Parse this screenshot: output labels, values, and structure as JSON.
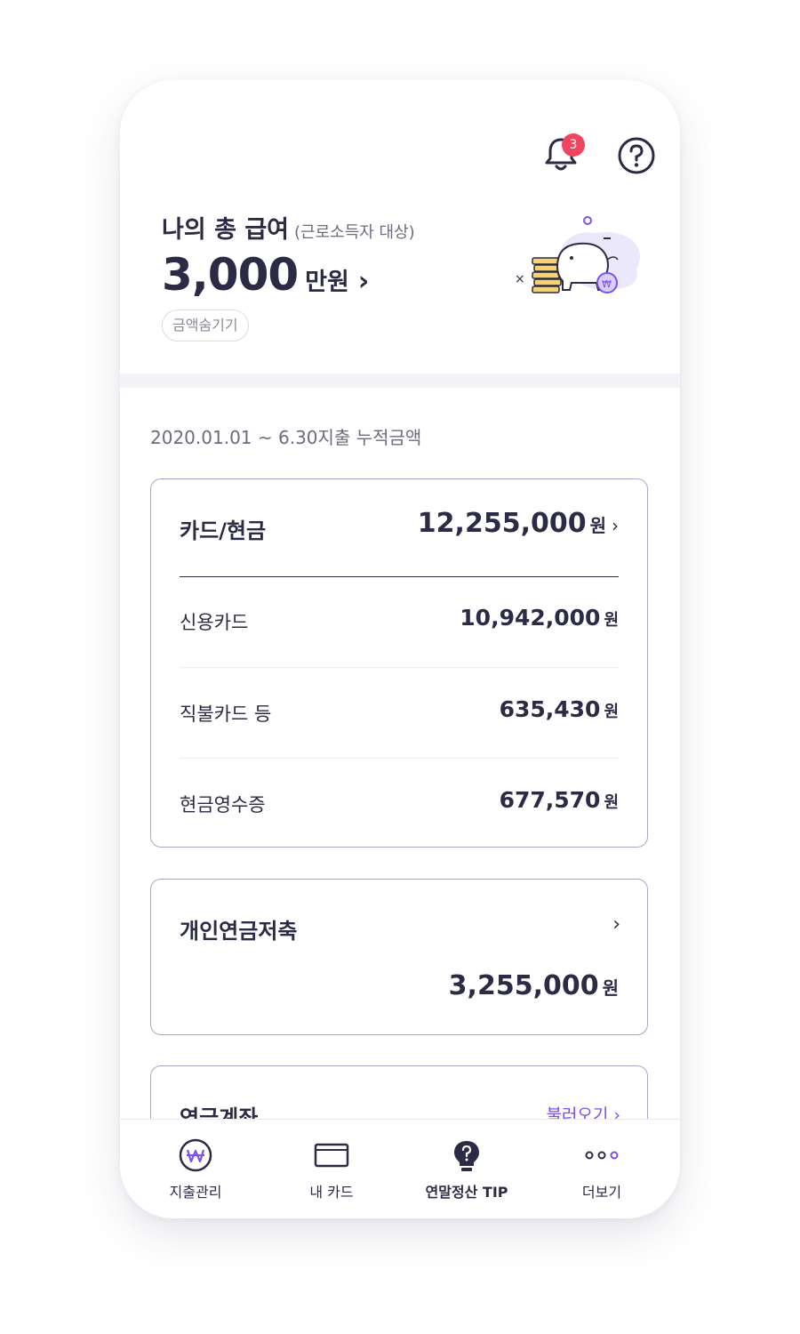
{
  "header": {
    "notification_count": "3",
    "bell_icon": "bell-icon",
    "help_icon": "help-icon"
  },
  "salary": {
    "title": "나의 총 급여",
    "subtitle": "(근로소득자 대상)",
    "amount": "3,000",
    "unit": "만원",
    "chevron": "›",
    "hide_button": "금액숨기기",
    "illustration_icon": "piggy-bank-coins-icon"
  },
  "period": {
    "text": "2020.01.01 ~ 6.30지출 누적금액"
  },
  "card_cash": {
    "label": "카드/현금",
    "total": "12,255,000",
    "currency": "원",
    "chevron": "›",
    "rows": [
      {
        "label": "신용카드",
        "amount": "10,942,000",
        "currency": "원"
      },
      {
        "label": "직불카드 등",
        "amount": "635,430",
        "currency": "원"
      },
      {
        "label": "현금영수증",
        "amount": "677,570",
        "currency": "원"
      }
    ]
  },
  "pension": {
    "label": "개인연금저축",
    "amount": "3,255,000",
    "currency": "원",
    "chevron": "›"
  },
  "pension_account": {
    "label": "연금계좌",
    "link": "불러오기 ›"
  },
  "tabs": [
    {
      "label": "지출관리",
      "icon": "won-coin-icon",
      "active": false
    },
    {
      "label": "내 카드",
      "icon": "card-icon",
      "active": false
    },
    {
      "label": "연말정산 TIP",
      "icon": "tip-bulb-icon",
      "active": true
    },
    {
      "label": "더보기",
      "icon": "more-dots-icon",
      "active": false
    }
  ],
  "colors": {
    "primary_text": "#2b2b45",
    "accent_purple": "#7b4ff0",
    "badge_red": "#f0445f",
    "card_border": "#aba6c9"
  }
}
